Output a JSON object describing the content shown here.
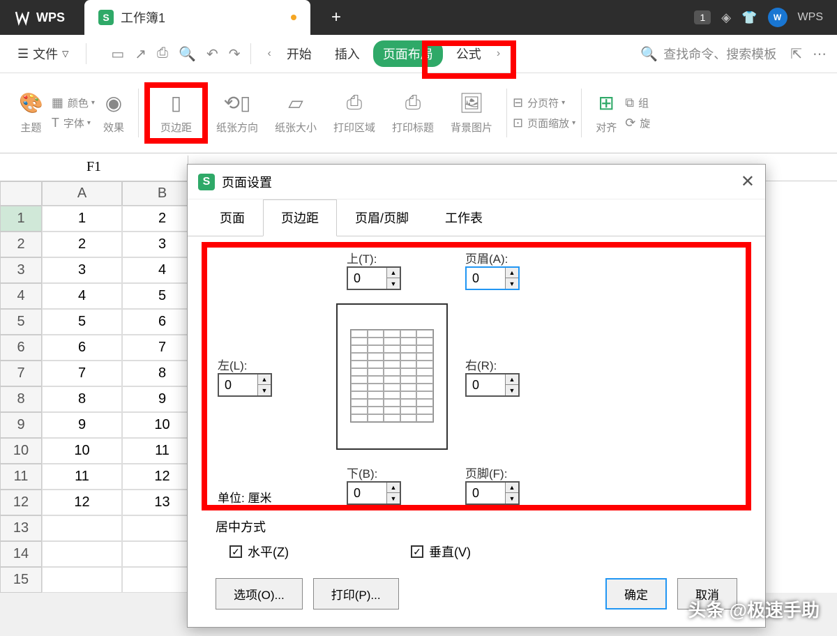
{
  "titlebar": {
    "app": "WPS",
    "tab_title": "工作簿1",
    "badge": "1",
    "right_text": "WPS"
  },
  "menubar": {
    "file": "文件",
    "tabs": [
      "开始",
      "插入",
      "页面布局",
      "公式"
    ],
    "search_placeholder": "查找命令、搜索模板"
  },
  "ribbon": {
    "theme": "主题",
    "colors": "颜色",
    "fonts": "字体",
    "effects": "效果",
    "margins": "页边距",
    "orientation": "纸张方向",
    "size": "纸张大小",
    "print_area": "打印区域",
    "print_titles": "打印标题",
    "background": "背景图片",
    "breaks": "分页符",
    "scale": "页面缩放",
    "align": "对齐",
    "group": "组",
    "rotate": "旋"
  },
  "formula_bar": {
    "cell_ref": "F1"
  },
  "sheet": {
    "columns": [
      "A",
      "B"
    ],
    "rows": [
      {
        "n": 1,
        "a": "1",
        "b": "2"
      },
      {
        "n": 2,
        "a": "2",
        "b": "3"
      },
      {
        "n": 3,
        "a": "3",
        "b": "4"
      },
      {
        "n": 4,
        "a": "4",
        "b": "5"
      },
      {
        "n": 5,
        "a": "5",
        "b": "6"
      },
      {
        "n": 6,
        "a": "6",
        "b": "7"
      },
      {
        "n": 7,
        "a": "7",
        "b": "8"
      },
      {
        "n": 8,
        "a": "8",
        "b": "9"
      },
      {
        "n": 9,
        "a": "9",
        "b": "10"
      },
      {
        "n": 10,
        "a": "10",
        "b": "11"
      },
      {
        "n": 11,
        "a": "11",
        "b": "12"
      },
      {
        "n": 12,
        "a": "12",
        "b": "13"
      },
      {
        "n": 13,
        "a": "",
        "b": ""
      },
      {
        "n": 14,
        "a": "",
        "b": ""
      },
      {
        "n": 15,
        "a": "",
        "b": ""
      }
    ]
  },
  "dialog": {
    "title": "页面设置",
    "tabs": [
      "页面",
      "页边距",
      "页眉/页脚",
      "工作表"
    ],
    "top_label": "上(T):",
    "header_label": "页眉(A):",
    "left_label": "左(L):",
    "right_label": "右(R):",
    "bottom_label": "下(B):",
    "footer_label": "页脚(F):",
    "unit_label": "单位:",
    "unit_value": "厘米",
    "top_val": "0",
    "header_val": "0",
    "left_val": "0",
    "right_val": "0",
    "bottom_val": "0",
    "footer_val": "0",
    "center_label": "居中方式",
    "horizontal": "水平(Z)",
    "vertical": "垂直(V)",
    "options_btn": "选项(O)...",
    "print_btn": "打印(P)...",
    "ok_btn": "确定",
    "cancel_btn": "取消"
  },
  "watermark": "头条 @极速手助"
}
